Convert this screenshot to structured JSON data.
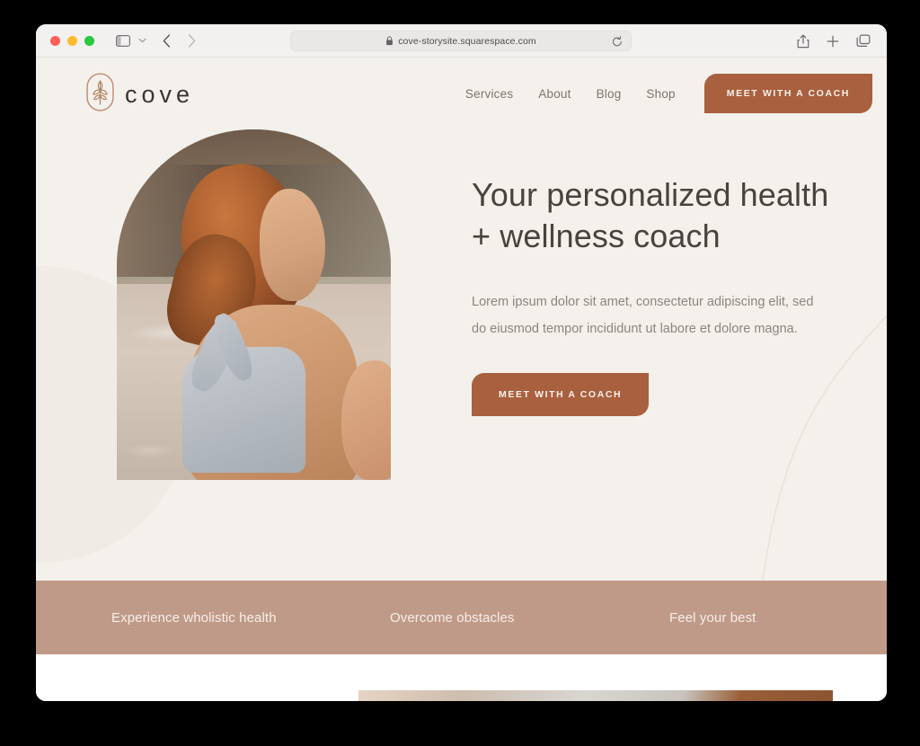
{
  "browser": {
    "url": "cove-storysite.squarespace.com",
    "lock_icon": "lock-icon",
    "reload_icon": "reload-icon",
    "sidebar_icon": "sidebar-toggle-icon",
    "chevron_icon": "chevron-down-icon",
    "back_icon": "back-arrow-icon",
    "forward_icon": "forward-arrow-icon",
    "share_icon": "share-icon",
    "new_tab_icon": "plus-icon",
    "tabs_icon": "tab-overview-icon",
    "traffic_lights": {
      "close": "#ff5f57",
      "minimize": "#febc2e",
      "maximize": "#28c840"
    }
  },
  "site": {
    "logo": {
      "mark": "wheat-sprig-in-arch-icon",
      "wordmark": "cove"
    },
    "nav": {
      "links": [
        {
          "label": "Services"
        },
        {
          "label": "About"
        },
        {
          "label": "Blog"
        },
        {
          "label": "Shop"
        }
      ],
      "cta_label": "MEET WITH A COACH"
    },
    "hero": {
      "image_alt": "smiling woman in grey sports bra on a beach",
      "headline": "Your personalized health + wellness coach",
      "paragraph": "Lorem ipsum dolor sit amet, consectetur adipiscing elit, sed do eiusmod tempor incididunt ut labore et dolore magna.",
      "cta_label": "MEET WITH A COACH"
    },
    "taglines": [
      {
        "label": "Experience wholistic health"
      },
      {
        "label": "Overcome obstacles"
      },
      {
        "label": "Feel your best"
      }
    ]
  },
  "colors": {
    "page_background": "#f4f1ec",
    "accent_terracotta": "#a9603f",
    "banner_rose": "#c09a88",
    "heading_text": "#4a423c",
    "body_text": "#8d857e",
    "nav_text": "#7d756e"
  }
}
